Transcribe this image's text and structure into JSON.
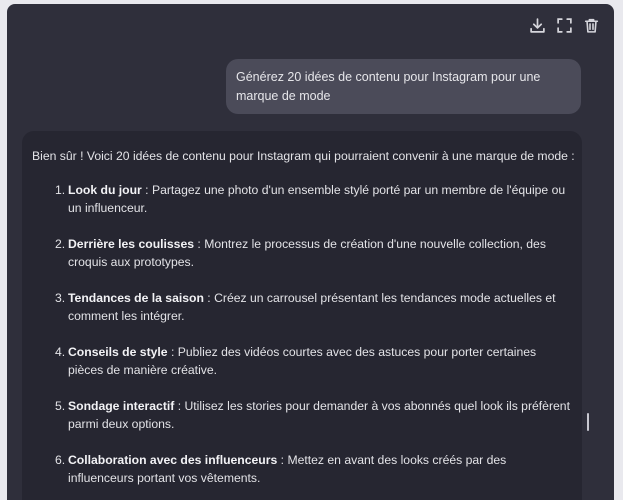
{
  "toolbar": {
    "icons": [
      "download-icon",
      "fullscreen-icon",
      "trash-icon"
    ]
  },
  "user_message": "Générez 20 idées de contenu pour Instagram pour une marque de mode",
  "assistant": {
    "intro": "Bien sûr ! Voici 20 idées de contenu pour Instagram qui pourraient convenir à une marque de mode :",
    "ideas": [
      {
        "num": "1.",
        "title": "Look du jour",
        "text": " : Partagez une photo d'un ensemble stylé porté par un membre de l'équipe ou un influenceur."
      },
      {
        "num": "2.",
        "title": "Derrière les coulisses",
        "text": " : Montrez le processus de création d'une nouvelle collection, des croquis aux prototypes."
      },
      {
        "num": "3.",
        "title": "Tendances de la saison",
        "text": " : Créez un carrousel présentant les tendances mode actuelles et comment les intégrer."
      },
      {
        "num": "4.",
        "title": "Conseils de style",
        "text": " : Publiez des vidéos courtes avec des astuces pour porter certaines pièces de manière créative."
      },
      {
        "num": "5.",
        "title": "Sondage interactif",
        "text": " : Utilisez les stories pour demander à vos abonnés quel look ils préfèrent parmi deux options."
      },
      {
        "num": "6.",
        "title": "Collaboration avec des influenceurs",
        "text": " : Mettez en avant des looks créés par des influenceurs portant vos vêtements."
      }
    ]
  },
  "colors": {
    "window_bg": "#2f2f3b",
    "panel_bg": "#262631",
    "user_bubble_bg": "#4b4b59",
    "text": "#e3e3e7"
  }
}
